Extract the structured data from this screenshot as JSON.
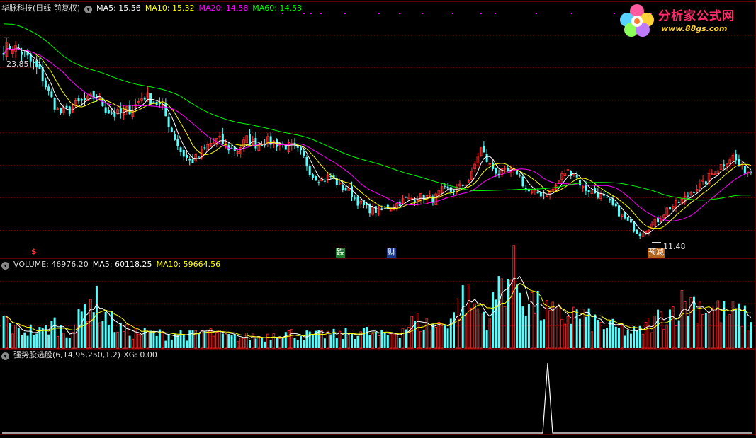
{
  "colors": {
    "background": "#000000",
    "up": "#ff3232",
    "down": "#54ffff",
    "ma5": "#ffffff",
    "ma10": "#ffff00",
    "ma20": "#ff00ff",
    "ma60": "#00ff00",
    "grid": "#8b0000",
    "separator": "#b00000",
    "xg": "#ffffff"
  },
  "header": {
    "title": "华脉科技(日线 前复权)",
    "ma5": "MA5: 15.56",
    "ma10": "MA10: 15.32",
    "ma20": "MA20: 14.58",
    "ma60": "MA60: 14.53"
  },
  "logo": {
    "brand": "分析家公式网",
    "url": "www.88gs.com"
  },
  "volume_header": {
    "volume": "VOLUME: 46976.20",
    "ma5": "MA5: 60118.25",
    "ma10": "MA10: 59664.56"
  },
  "indicator_header": {
    "name": "强势股选股(6,14,95,250,1,2)",
    "xg": "XG: 0.00"
  },
  "annotations": {
    "high_price": "23.85",
    "low_price": "11.48",
    "marker_s": "$",
    "marker_die": "跌",
    "marker_cai": "财",
    "marker_yujian": "预减"
  },
  "chart_data": [
    {
      "type": "candlestick",
      "title": "华脉科技(日线 前复权)",
      "ylim": [
        10.5,
        25.3
      ],
      "annotations": [
        {
          "label": "23.85",
          "kind": "period high"
        },
        {
          "label": "11.48",
          "kind": "period low"
        }
      ],
      "series": [
        {
          "name": "MA5",
          "last": 15.56
        },
        {
          "name": "MA10",
          "last": 15.32
        },
        {
          "name": "MA20",
          "last": 14.58
        },
        {
          "name": "MA60",
          "last": 14.53
        }
      ],
      "waypoints_close": [
        23.2,
        23.3,
        22.9,
        22.3,
        21.6,
        20.2,
        19.2,
        19.4,
        19.8,
        20.0,
        20.3,
        19.4,
        19.1,
        19.3,
        19.6,
        20.3,
        20.0,
        19.5,
        18.1,
        16.8,
        16.2,
        16.6,
        17.3,
        17.6,
        17.1,
        16.9,
        17.6,
        17.3,
        17.5,
        17.4,
        17.2,
        17.1,
        16.6,
        15.4,
        15.1,
        15.3,
        14.7,
        14.4,
        13.7,
        13.3,
        13.2,
        13.4,
        13.6,
        13.9,
        14.0,
        14.1,
        13.9,
        14.5,
        14.4,
        14.7,
        15.2,
        17.1,
        16.0,
        15.5,
        15.6,
        15.6,
        14.4,
        14.3,
        14.2,
        14.6,
        15.6,
        15.6,
        14.6,
        14.4,
        14.1,
        13.6,
        13.0,
        12.4,
        11.8,
        12.2,
        12.6,
        13.3,
        13.6,
        14.0,
        14.6,
        14.9,
        15.6,
        16.1,
        16.6,
        15.8,
        15.56
      ],
      "grid": true
    },
    {
      "type": "bar",
      "title": "VOLUME",
      "series": [
        {
          "name": "VOLUME",
          "last": 46976.2
        },
        {
          "name": "MA5",
          "last": 60118.25
        },
        {
          "name": "MA10",
          "last": 59664.56
        }
      ],
      "ylim": [
        0,
        140000
      ],
      "waypoints_volume": [
        52000,
        30000,
        33000,
        28000,
        45000,
        26000,
        48000,
        95000,
        62000,
        40000,
        28000,
        27000,
        26000,
        24000,
        28000,
        22000,
        30000,
        25000,
        20000,
        18000,
        21000,
        20000,
        30000,
        26000,
        24000,
        22000,
        25000,
        23000,
        28000,
        30000,
        22000,
        25000,
        35000,
        48000,
        42000,
        40000,
        60000,
        92000,
        70000,
        55000,
        125000,
        130000,
        88000,
        70000,
        60000,
        55000,
        62000,
        50000,
        42000,
        36000,
        30000,
        28000,
        45000,
        60000,
        72000,
        85000,
        78000,
        70000,
        60000,
        62000,
        46976
      ]
    },
    {
      "type": "line",
      "title": "强势股选股(6,14,95,250,1,2)",
      "series": [
        {
          "name": "XG",
          "last": 0.0
        }
      ],
      "signal_count": 1,
      "values_note_last": 0.0
    }
  ]
}
